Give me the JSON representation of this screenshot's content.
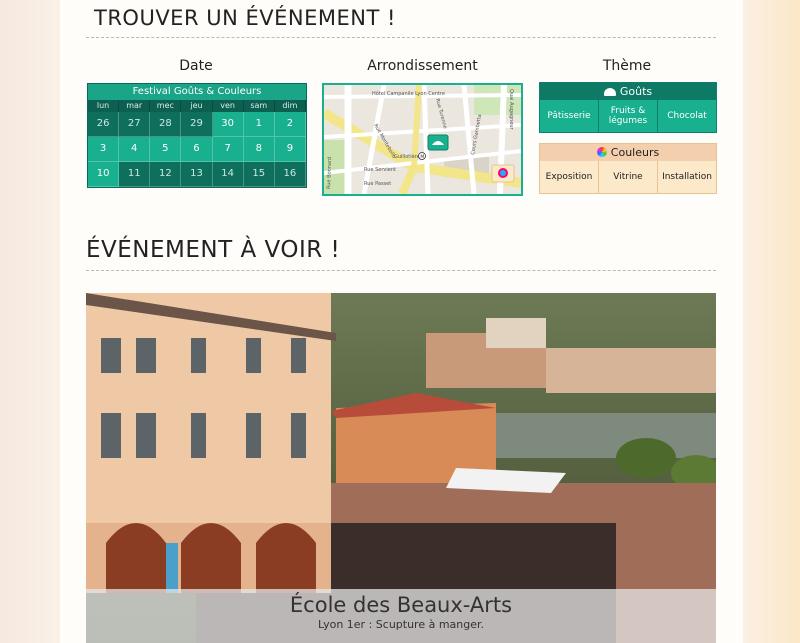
{
  "search": {
    "title": "TROUVER UN ÉVÉNEMENT !",
    "date_title": "Date",
    "arr_title": "Arrondissement",
    "theme_title": "Thème"
  },
  "calendar": {
    "header": "Festival Goûts & Couleurs",
    "days": [
      "lun",
      "mar",
      "mec",
      "jeu",
      "ven",
      "sam",
      "dim"
    ],
    "rows": [
      [
        "26",
        "27",
        "28",
        "29",
        "30",
        "1",
        "2"
      ],
      [
        "3",
        "4",
        "5",
        "6",
        "7",
        "8",
        "9"
      ],
      [
        "10",
        "11",
        "12",
        "13",
        "14",
        "15",
        "16"
      ]
    ]
  },
  "map": {
    "labels": [
      "Hôtel Campanile Lyon Centre",
      "Rue Montebello",
      "Rue Turenne",
      "Quai Augagneur",
      "Cours Gambetta",
      "Guillotière",
      "Rue Passet",
      "Rue Bonnard",
      "Rue Servient"
    ]
  },
  "themes": {
    "gouts": {
      "label": "Goûts",
      "options": [
        "Pâtisserie",
        "Fruits & légumes",
        "Chocolat"
      ]
    },
    "couleurs": {
      "label": "Couleurs",
      "options": [
        "Exposition",
        "Vitrine",
        "Installation"
      ]
    }
  },
  "event": {
    "title": "ÉVÉNEMENT À VOIR !",
    "photo_title": "École des Beaux-Arts",
    "photo_sub": "Lyon 1er : Scupture à manger."
  }
}
